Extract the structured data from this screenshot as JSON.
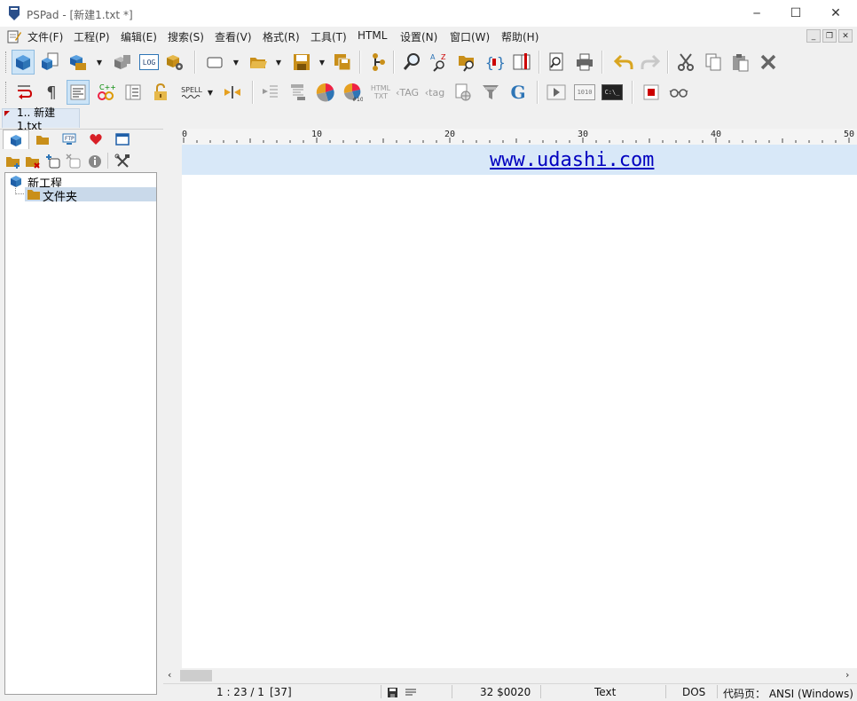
{
  "window": {
    "title": "PSPad - [新建1.txt *]",
    "controls": {
      "minimize": "─",
      "maximize": "☐",
      "close": "✕"
    }
  },
  "menu": {
    "items": [
      "文件(F)",
      "工程(P)",
      "编辑(E)",
      "搜索(S)",
      "查看(V)",
      "格式(R)",
      "工具(T)",
      "HTML",
      "设置(N)",
      "窗口(W)",
      "帮助(H)"
    ],
    "mdi_controls": [
      "_",
      "❐",
      "✕"
    ]
  },
  "toolbar": {
    "log_label": "LOG",
    "spell_label": "SPELL",
    "html_txt_label": "HTML",
    "html_txt_sub": "TXT",
    "tag_upper": "TAG",
    "tag_lower": "tag",
    "google_label": "G",
    "binary_label": "1010",
    "console_label": "C:\\_"
  },
  "tabs": {
    "document": "1.. 新建1.txt"
  },
  "project": {
    "root": "新工程",
    "folder": "文件夹"
  },
  "ruler": {
    "labels": [
      "0",
      "10",
      "20",
      "30",
      "40",
      "50"
    ]
  },
  "editor": {
    "content": "www.udashi.com",
    "link_color": "#0000c0",
    "current_line_color": "#d8e8f8"
  },
  "status": {
    "position": "1 : 23 / 1",
    "length": "[37]",
    "char_code": "32  $0020",
    "mode": "Text",
    "line_ending": "DOS",
    "codepage": "代码页： ANSI (Windows)"
  },
  "colors": {
    "accent": "#2e75b6",
    "folder": "#c98f1a",
    "selection": "#c9d9ea"
  }
}
